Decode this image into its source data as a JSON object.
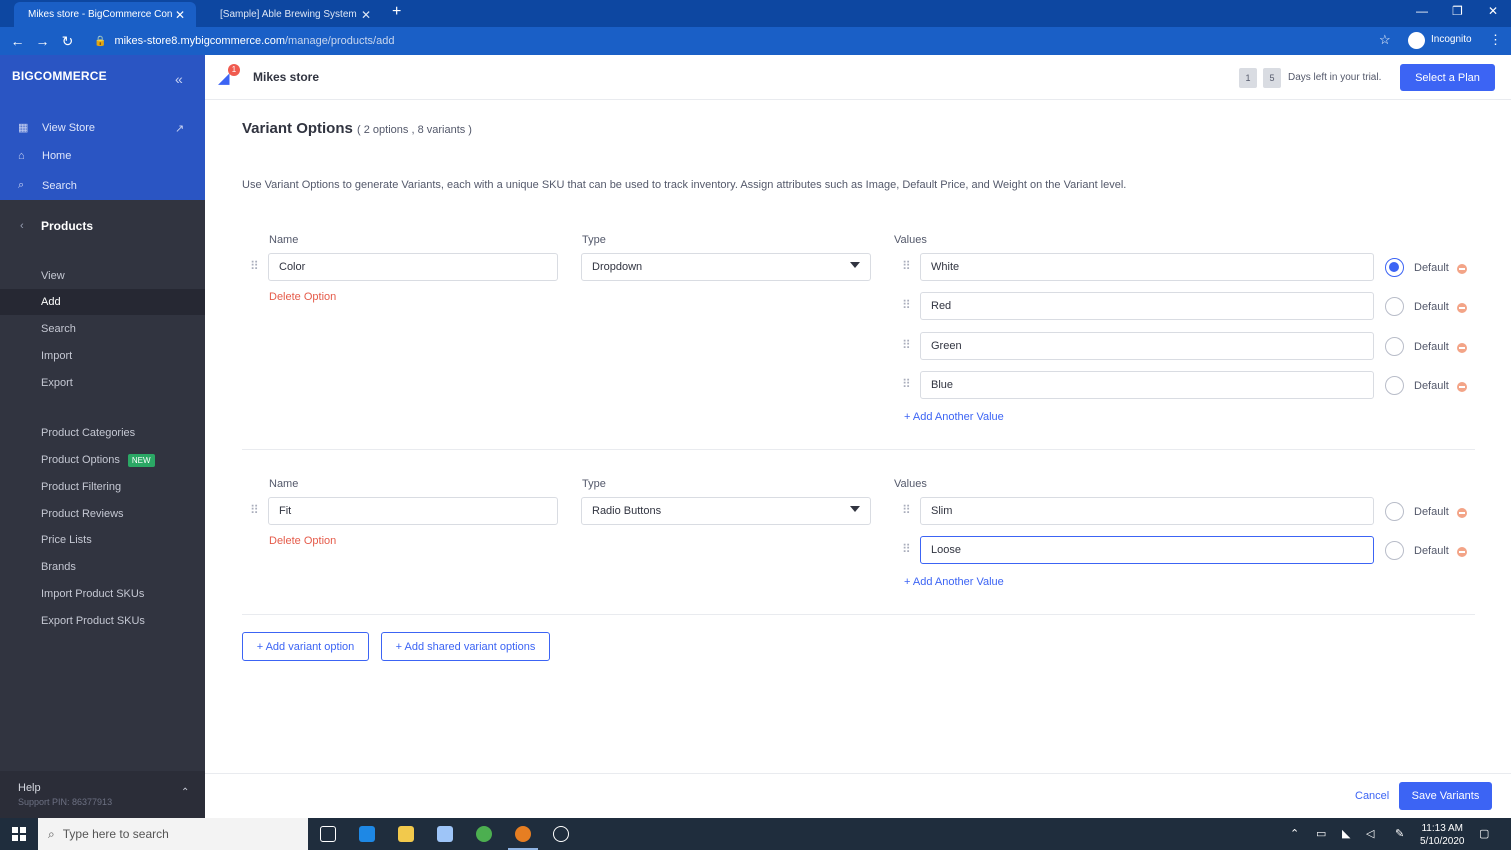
{
  "browser": {
    "tabs": [
      {
        "title": "Mikes store - BigCommerce Con",
        "active": true
      },
      {
        "title": "[Sample] Able Brewing System -",
        "active": false
      }
    ],
    "url_host": "mikes-store8.mybigcommerce.com",
    "url_path": "/manage/products/add",
    "incognito_label": "Incognito"
  },
  "sidebar": {
    "logo": "BIGCOMMERCE",
    "top_items": [
      {
        "label": "View Store",
        "icon": "store-icon"
      },
      {
        "label": "Home",
        "icon": "home-icon"
      },
      {
        "label": "Search",
        "icon": "search-icon"
      }
    ],
    "section": "Products",
    "items": [
      {
        "label": "View"
      },
      {
        "label": "Add",
        "active": true
      },
      {
        "label": "Search"
      },
      {
        "label": "Import"
      },
      {
        "label": "Export"
      },
      {
        "label": "Product Categories"
      },
      {
        "label": "Product Options",
        "badge": "NEW"
      },
      {
        "label": "Product Filtering"
      },
      {
        "label": "Product Reviews"
      },
      {
        "label": "Price Lists"
      },
      {
        "label": "Brands"
      },
      {
        "label": "Import Product SKUs"
      },
      {
        "label": "Export Product SKUs"
      }
    ],
    "help": {
      "title": "Help",
      "support": "Support PIN: 86377913"
    }
  },
  "header": {
    "notification_count": "1",
    "store_name": "Mikes store",
    "trial_days": [
      "1",
      "5"
    ],
    "trial_text": "Days left in your trial.",
    "select_plan": "Select a Plan"
  },
  "main": {
    "title": "Variant Options",
    "subtitle": "( 2 options , 8 variants )",
    "description": "Use Variant Options to generate Variants, each with a unique SKU that can be used to track inventory. Assign attributes such as Image, Default Price, and Weight on the Variant level.",
    "labels": {
      "name": "Name",
      "type": "Type",
      "values": "Values"
    },
    "delete_option": "Delete Option",
    "add_another_value": "+ Add Another Value",
    "default_label": "Default",
    "options": [
      {
        "name": "Color",
        "type": "Dropdown",
        "values": [
          {
            "value": "White",
            "default": true
          },
          {
            "value": "Red",
            "default": false
          },
          {
            "value": "Green",
            "default": false
          },
          {
            "value": "Blue",
            "default": false
          }
        ]
      },
      {
        "name": "Fit",
        "type": "Radio Buttons",
        "values": [
          {
            "value": "Slim",
            "default": false
          },
          {
            "value": "Loose",
            "default": false,
            "focused": true
          }
        ]
      }
    ],
    "add_variant_option": "+ Add variant option",
    "add_shared_variant_options": "+ Add shared variant options"
  },
  "footer": {
    "cancel": "Cancel",
    "save": "Save Variants"
  },
  "taskbar": {
    "search_placeholder": "Type here to search",
    "time": "11:13 AM",
    "date": "5/10/2020"
  },
  "colors": {
    "brand_blue": "#3c64f4",
    "sidebar_dark": "#313440",
    "danger": "#e55b4a"
  }
}
